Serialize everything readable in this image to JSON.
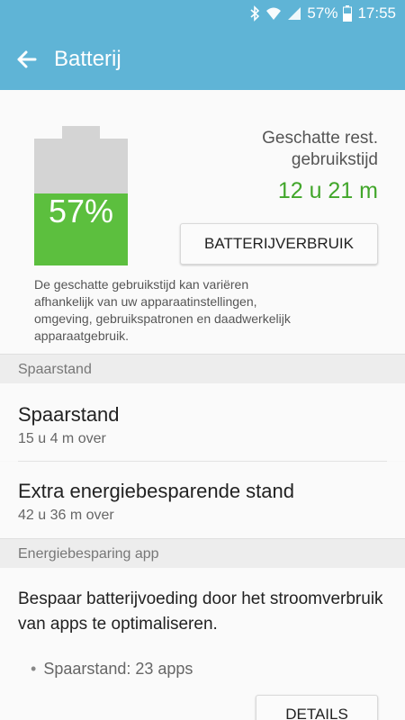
{
  "status_bar": {
    "battery_text": "57%",
    "time": "17:55",
    "icons": [
      "bluetooth-icon",
      "wifi-icon",
      "signal-icon",
      "battery-icon"
    ]
  },
  "app_bar": {
    "title": "Batterij",
    "back_icon": "arrow-left-icon"
  },
  "battery_card": {
    "level_percent": 57,
    "level_label": "57%",
    "estimate_label": "Geschatte rest. gebruikstijd",
    "estimate_time": "12 u 21 m",
    "usage_button_label": "BATTERIJVERBRUIK",
    "note": "De geschatte gebruikstijd kan variëren afhankelijk van uw apparaatinstellingen, omgeving, gebruikspatronen en daadwerkelijk apparaatgebruik."
  },
  "power_saving_section": {
    "header": "Spaarstand",
    "items": [
      {
        "title": "Spaarstand",
        "subtitle": "15 u 4 m over"
      },
      {
        "title": "Extra energiebesparende stand",
        "subtitle": "42 u 36 m over"
      }
    ]
  },
  "app_saving_section": {
    "header": "Energiebesparing app",
    "description": "Bespaar batterijvoeding door het stroomverbruik van apps te optimaliseren.",
    "bullet": "Spaarstand: 23 apps",
    "details_button_label": "DETAILS"
  },
  "colors": {
    "accent": "#5fb4d6",
    "battery_green": "#5cbf3e",
    "time_green": "#41a62a"
  }
}
